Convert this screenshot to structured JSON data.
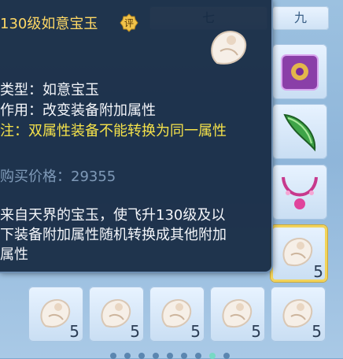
{
  "tabs": {
    "tab7": "七",
    "tab9": "九"
  },
  "tooltip": {
    "title": "130级如意宝玉",
    "badge": "评",
    "type_line": "类型：如意宝玉",
    "effect_line": "作用：改变装备附加属性",
    "note_line": "注：双属性装备不能转换为同一属性",
    "price_label": "购买价格：",
    "price_value": "29355",
    "desc_line1": "来自天界的宝玉，使飞升130级及以",
    "desc_line2": "下装备附加属性随机转换成其他附加",
    "desc_line3": "属性"
  },
  "inventory": {
    "selected_count": "5",
    "bottom_counts": [
      "5",
      "5",
      "5",
      "5",
      "5"
    ],
    "icons": [
      "purple-bag-icon",
      "green-jade-blade-icon",
      "pink-necklace-icon",
      "white-jade-icon"
    ]
  },
  "colors": {
    "title": "#ffd865",
    "note": "#f5e24a",
    "price": "#7f9ab8",
    "select_border": "#f2d35a"
  }
}
